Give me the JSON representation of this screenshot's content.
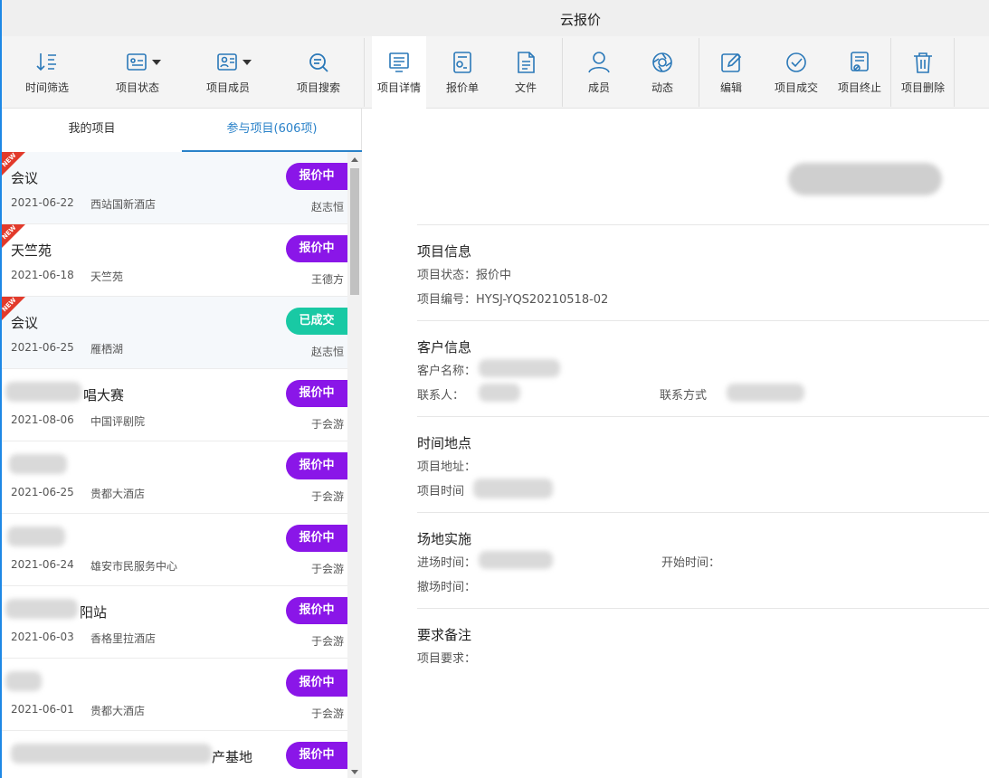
{
  "window": {
    "title": "云报价"
  },
  "toolbar": {
    "buttons": [
      {
        "label": "时间筛选"
      },
      {
        "label": "项目状态"
      },
      {
        "label": "项目成员"
      },
      {
        "label": "项目搜索"
      },
      {
        "label": "项目详情"
      },
      {
        "label": "报价单"
      },
      {
        "label": "文件"
      },
      {
        "label": "成员"
      },
      {
        "label": "动态"
      },
      {
        "label": "编辑"
      },
      {
        "label": "项目成交"
      },
      {
        "label": "项目终止"
      },
      {
        "label": "项目删除"
      }
    ]
  },
  "tabs": [
    {
      "label": "我的项目"
    },
    {
      "label": "参与项目(606项)"
    }
  ],
  "new_tag": "NEW",
  "projects": [
    {
      "name": "会议",
      "date": "2021-06-22",
      "place": "西站国新酒店",
      "owner": "赵志恒",
      "status": "报价中"
    },
    {
      "name": "天竺苑",
      "date": "2021-06-18",
      "place": "天竺苑",
      "owner": "王德方",
      "status": "报价中"
    },
    {
      "name": "会议",
      "date": "2021-06-25",
      "place": "雁栖湖",
      "owner": "赵志恒",
      "status": "已成交"
    },
    {
      "name": "唱大赛",
      "date": "2021-08-06",
      "place": "中国评剧院",
      "owner": "于会游",
      "status": "报价中"
    },
    {
      "name": "",
      "date": "2021-06-25",
      "place": "贵都大酒店",
      "owner": "于会游",
      "status": "报价中"
    },
    {
      "name": "",
      "date": "2021-06-24",
      "place": "雄安市民服务中心",
      "owner": "于会游",
      "status": "报价中"
    },
    {
      "name": "阳站",
      "date": "2021-06-03",
      "place": "香格里拉酒店",
      "owner": "于会游",
      "status": "报价中"
    },
    {
      "name": "",
      "date": "2021-06-01",
      "place": "贵都大酒店",
      "owner": "于会游",
      "status": "报价中"
    },
    {
      "name": "产基地",
      "date": "",
      "place": "",
      "owner": "",
      "status": "报价中"
    }
  ],
  "detail": {
    "project_info": {
      "heading": "项目信息",
      "status_label": "项目状态：",
      "status_value": "报价中",
      "code_label": "项目编号：",
      "code_value": "HYSJ-YQS20210518-02"
    },
    "customer_info": {
      "heading": "客户信息",
      "name_label": "客户名称：",
      "contact_label": "联系人：",
      "phone_label": "联系方式"
    },
    "time_place": {
      "heading": "时间地点",
      "address_label": "项目地址：",
      "time_label": "项目时间"
    },
    "venue": {
      "heading": "场地实施",
      "enter_label": "进场时间：",
      "start_label": "开始时间：",
      "exit_label": "撤场时间："
    },
    "remarks": {
      "heading": "要求备注",
      "req_label": "项目要求："
    }
  },
  "colors": {
    "accent": "#2a82c9",
    "quoting": "#8a16e8",
    "done": "#19c9a4",
    "new": "#e23a2b"
  }
}
